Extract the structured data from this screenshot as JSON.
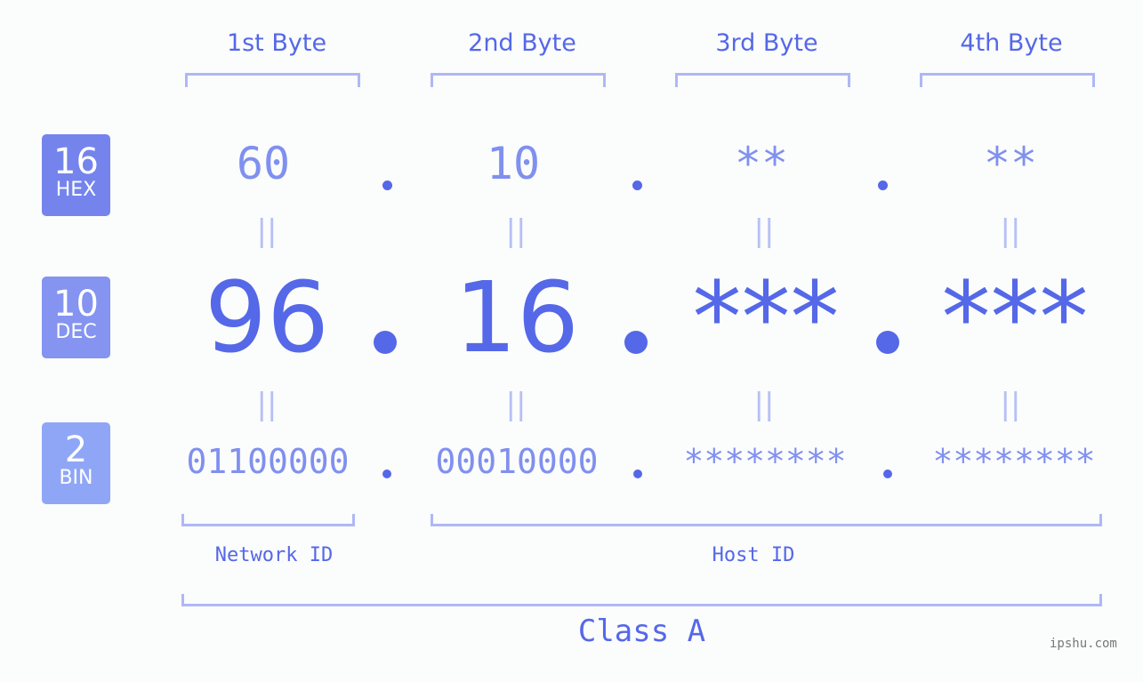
{
  "bytes_header": [
    "1st Byte",
    "2nd Byte",
    "3rd Byte",
    "4th Byte"
  ],
  "badges": [
    {
      "num": "16",
      "label": "HEX",
      "color": "#7484ec"
    },
    {
      "num": "10",
      "label": "DEC",
      "color": "#8494f0"
    },
    {
      "num": "2",
      "label": "BIN",
      "color": "#8fa6f7"
    }
  ],
  "hex": [
    "60",
    "10",
    "**",
    "**"
  ],
  "dec": [
    "96",
    "16",
    "***",
    "***"
  ],
  "bin": [
    "01100000",
    "00010000",
    "********",
    "********"
  ],
  "equals_sign": "||",
  "network_id_label": "Network ID",
  "host_id_label": "Host ID",
  "class_label": "Class A",
  "watermark": "ipshu.com",
  "colors": {
    "primary": "#5468e8",
    "light": "#8090ee",
    "bracket": "#aeb8f5"
  }
}
